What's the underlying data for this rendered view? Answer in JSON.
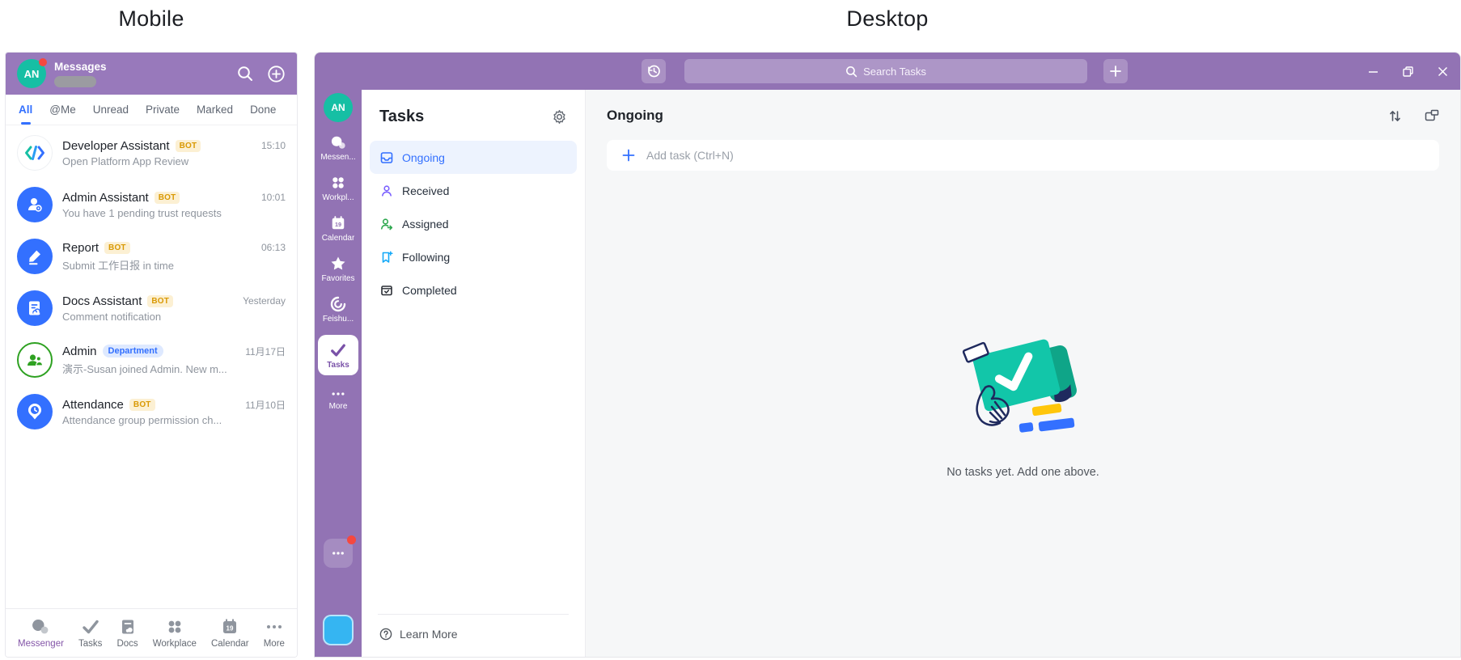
{
  "section_titles": {
    "mobile": "Mobile",
    "desktop": "Desktop"
  },
  "colors": {
    "mobile_header_purple": "#9879BB",
    "desktop_purple": "#9273B4",
    "accent_blue": "#3370FF",
    "avatar_teal": "#16BFA4",
    "notification_red": "#F5483F",
    "bot_badge_bg": "#FCF0D3",
    "bot_badge_text": "#D99904",
    "dept_badge_bg": "#DEE9FF",
    "dept_badge_text": "#3370FF",
    "selected_item_bg": "#EDF3FE",
    "main_bg": "#F6F7F8",
    "app_square_cyan": "#35B5F2",
    "illustration_teal": "#12C6A9"
  },
  "mobile": {
    "header": {
      "avatar_initials": "AN",
      "title": "Messages"
    },
    "tabs": [
      {
        "label": "All"
      },
      {
        "label": "@Me"
      },
      {
        "label": "Unread"
      },
      {
        "label": "Private"
      },
      {
        "label": "Marked"
      },
      {
        "label": "Done"
      }
    ],
    "chats": [
      {
        "name": "Developer Assistant",
        "badge": "BOT",
        "time": "15:10",
        "preview": "Open Platform App Review",
        "icon": "code-brackets-icon"
      },
      {
        "name": "Admin Assistant",
        "badge": "BOT",
        "time": "10:01",
        "preview": "You have 1 pending trust requests",
        "icon": "person-gear-icon"
      },
      {
        "name": "Report",
        "badge": "BOT",
        "time": "06:13",
        "preview": "Submit 工作日报 in time",
        "icon": "pencil-icon"
      },
      {
        "name": "Docs Assistant",
        "badge": "BOT",
        "time": "Yesterday",
        "preview": "Comment notification",
        "icon": "document-cloud-icon"
      },
      {
        "name": "Admin",
        "badge": "Department",
        "time": "11月17日",
        "preview": "演示-Susan joined Admin. New m...",
        "icon": "people-icon"
      },
      {
        "name": "Attendance",
        "badge": "BOT",
        "time": "11月10日",
        "preview": "Attendance group permission ch...",
        "icon": "pin-clock-icon"
      }
    ],
    "bottom_nav": [
      {
        "label": "Messenger",
        "icon": "chat-bubbles-icon"
      },
      {
        "label": "Tasks",
        "icon": "checkmark-icon"
      },
      {
        "label": "Docs",
        "icon": "docs-icon"
      },
      {
        "label": "Workplace",
        "icon": "grid-icon"
      },
      {
        "label": "Calendar",
        "icon": "calendar-icon"
      },
      {
        "label": "More",
        "icon": "ellipsis-icon"
      }
    ],
    "calendar_day": "19"
  },
  "desktop": {
    "titlebar": {
      "search_placeholder": "Search Tasks"
    },
    "rail": {
      "avatar_initials": "AN",
      "calendar_day": "19",
      "items": [
        {
          "label": "Messen...",
          "icon": "chat-bubbles-icon"
        },
        {
          "label": "Workpl...",
          "icon": "grid-icon"
        },
        {
          "label": "Calendar",
          "icon": "calendar-icon"
        },
        {
          "label": "Favorites",
          "icon": "star-icon"
        },
        {
          "label": "Feishu...",
          "icon": "swirl-icon"
        },
        {
          "label": "Tasks",
          "icon": "checkmark-icon"
        },
        {
          "label": "More",
          "icon": "ellipsis-icon"
        }
      ]
    },
    "sidebar": {
      "title": "Tasks",
      "items": [
        {
          "label": "Ongoing",
          "icon": "inbox-icon"
        },
        {
          "label": "Received",
          "icon": "person-icon"
        },
        {
          "label": "Assigned",
          "icon": "person-arrow-icon"
        },
        {
          "label": "Following",
          "icon": "bookmark-plus-icon"
        },
        {
          "label": "Completed",
          "icon": "box-check-icon"
        }
      ],
      "footer_label": "Learn More"
    },
    "main": {
      "title": "Ongoing",
      "add_task_placeholder": "Add task (Ctrl+N)",
      "empty_message": "No tasks yet. Add one above."
    }
  }
}
